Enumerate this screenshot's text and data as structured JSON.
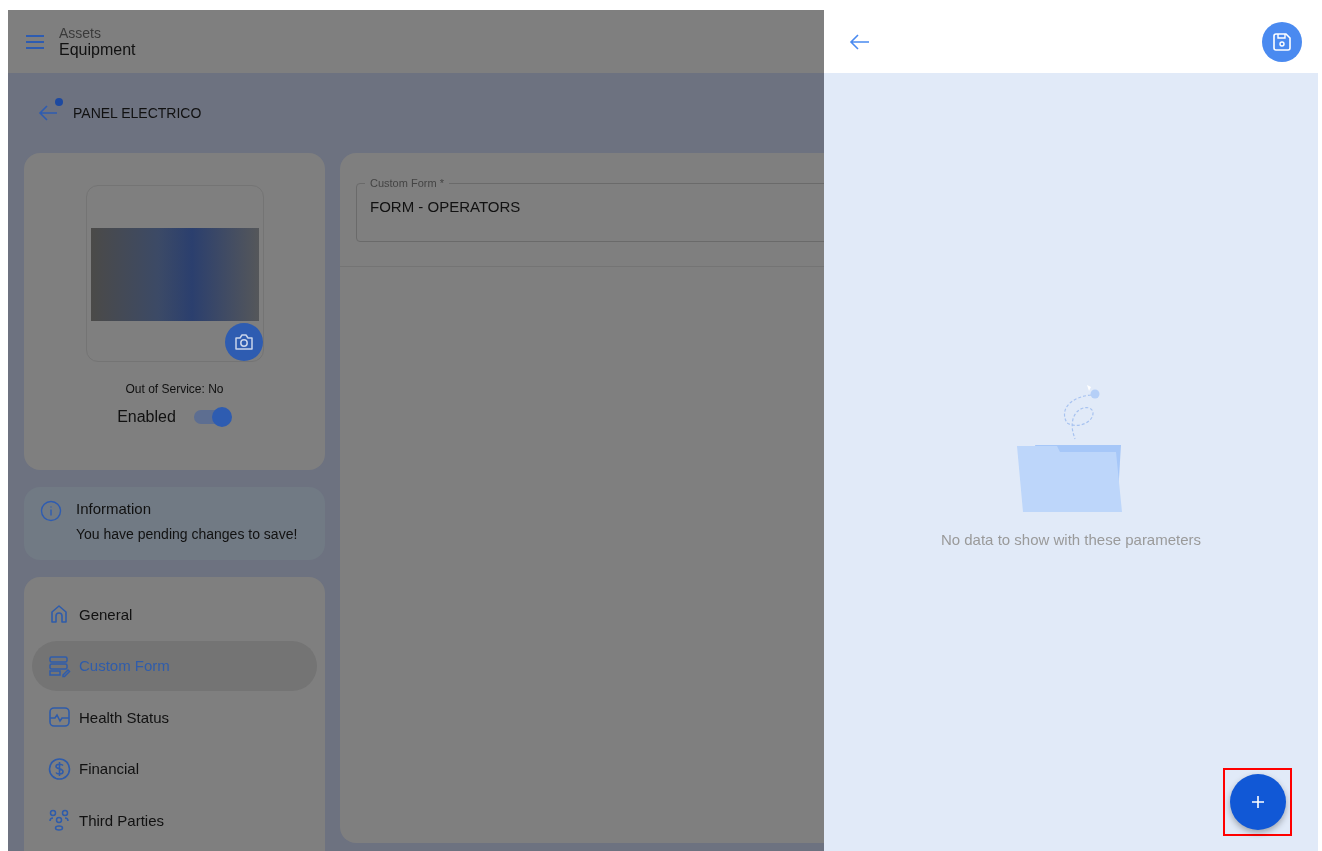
{
  "header": {
    "section": "Assets",
    "title": "Equipment"
  },
  "asset": {
    "name": "PANEL ELECTRICO",
    "unsaved_dot": true,
    "out_of_service": "Out of Service: No",
    "enabled_label": "Enabled",
    "enabled": true
  },
  "info": {
    "title": "Information",
    "message": "You have pending changes to save!"
  },
  "menu": [
    {
      "label": "General",
      "kind": "home",
      "selected": false
    },
    {
      "label": "Custom Form",
      "kind": "form",
      "selected": true
    },
    {
      "label": "Health Status",
      "kind": "health",
      "selected": false
    },
    {
      "label": "Financial",
      "kind": "dollar",
      "selected": false
    },
    {
      "label": "Third Parties",
      "kind": "people",
      "selected": false
    }
  ],
  "custom_form": {
    "label": "Custom Form *",
    "value": "FORM - OPERATORS"
  },
  "drawer": {
    "empty_message": "No data to show with these parameters"
  }
}
